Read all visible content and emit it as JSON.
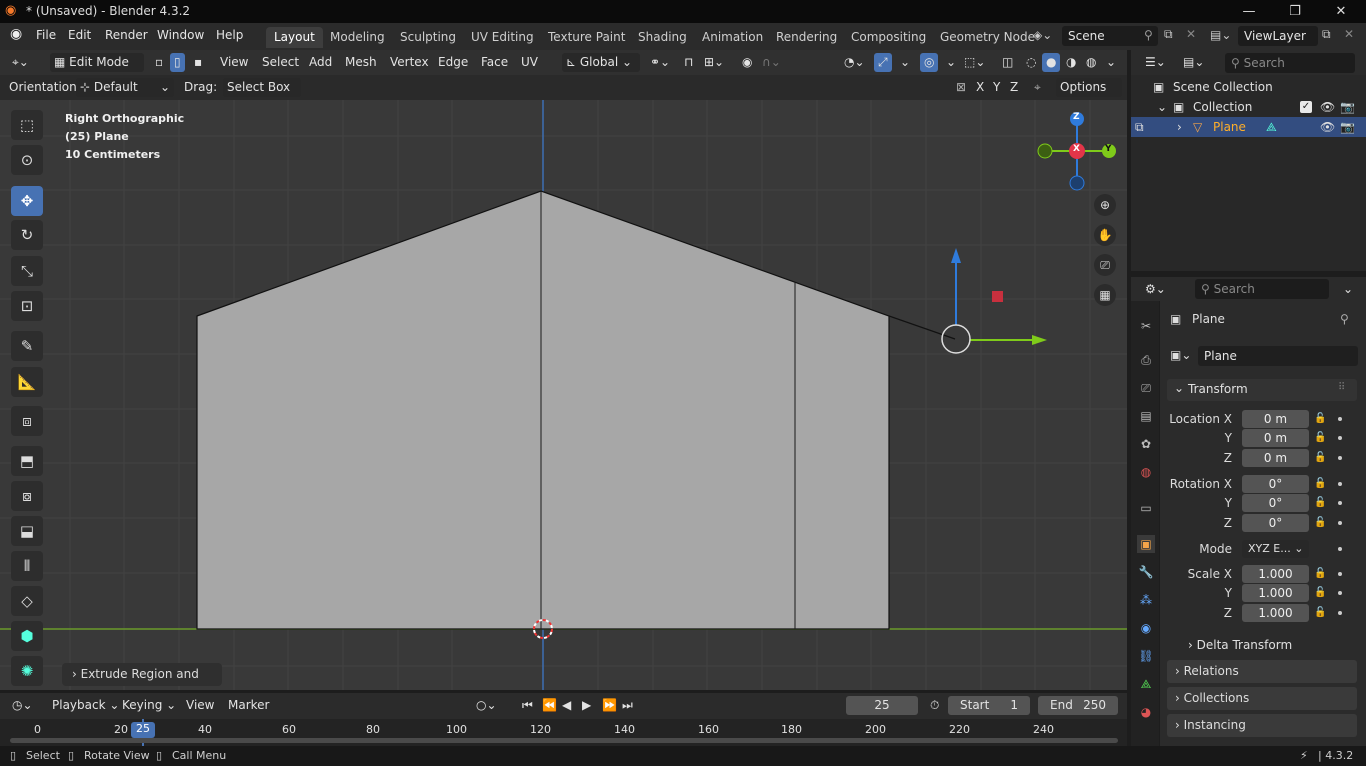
{
  "window": {
    "title": "* (Unsaved) - Blender 4.3.2",
    "controls": {
      "minimize": "—",
      "maximize": "❐",
      "close": "✕"
    }
  },
  "menu": {
    "items": [
      "File",
      "Edit",
      "Render",
      "Window",
      "Help"
    ],
    "workspaces": [
      "Layout",
      "Modeling",
      "Sculpting",
      "UV Editing",
      "Texture Paint",
      "Shading",
      "Animation",
      "Rendering",
      "Compositing",
      "Geometry Node"
    ],
    "active_workspace": "Layout",
    "scene": "Scene",
    "view_layer": "ViewLayer"
  },
  "viewport_header": {
    "mode": "Edit Mode",
    "menus": [
      "View",
      "Select",
      "Add",
      "Mesh",
      "Vertex",
      "Edge",
      "Face",
      "UV"
    ],
    "transform_orientation": "Global"
  },
  "tool_settings": {
    "orientation_label": "Orientation:",
    "orientation_value": "Default",
    "drag_label": "Drag:",
    "drag_value": "Select Box",
    "axes": [
      "X",
      "Y",
      "Z"
    ],
    "options": "Options"
  },
  "viewport": {
    "view_name": "Right Orthographic",
    "object_line": "(25) Plane",
    "scale_line": "10 Centimeters",
    "gizmo": {
      "z": "Z",
      "x": "X",
      "y": "Y"
    },
    "last_operator": "Extrude Region and Move"
  },
  "timeline": {
    "menus": [
      "Playback",
      "Keying",
      "View",
      "Marker"
    ],
    "current_frame": "25",
    "start_label": "Start",
    "start": "1",
    "end_label": "End",
    "end": "250",
    "ruler": [
      "0",
      "20",
      "40",
      "60",
      "80",
      "100",
      "120",
      "140",
      "160",
      "180",
      "200",
      "220",
      "240"
    ],
    "playhead_label": "25"
  },
  "status_bar": {
    "items": [
      "Select",
      "Rotate View",
      "Call Menu"
    ],
    "version": "4.3.2"
  },
  "outliner": {
    "search_placeholder": "Search",
    "rows": [
      "Scene Collection",
      "Collection",
      "Plane"
    ]
  },
  "properties": {
    "search_placeholder": "Search",
    "object_name": "Plane",
    "data_name": "Plane",
    "transform_title": "Transform",
    "location_label": "Location X",
    "rotation_label": "Rotation X",
    "mode_label": "Mode",
    "scale_label": "Scale X",
    "axis_y": "Y",
    "axis_z": "Z",
    "location": [
      "0 m",
      "0 m",
      "0 m"
    ],
    "rotation": [
      "0°",
      "0°",
      "0°"
    ],
    "mode": "XYZ E...",
    "scale": [
      "1.000",
      "1.000",
      "1.000"
    ],
    "delta_transform": "Delta Transform",
    "panels": [
      "Relations",
      "Collections",
      "Instancing"
    ]
  },
  "colors": {
    "accent": "#4772b3",
    "active_object": "#ffaf29",
    "x_axis": "#ff3352",
    "y_axis": "#8bdc00",
    "z_axis": "#2890ff"
  }
}
